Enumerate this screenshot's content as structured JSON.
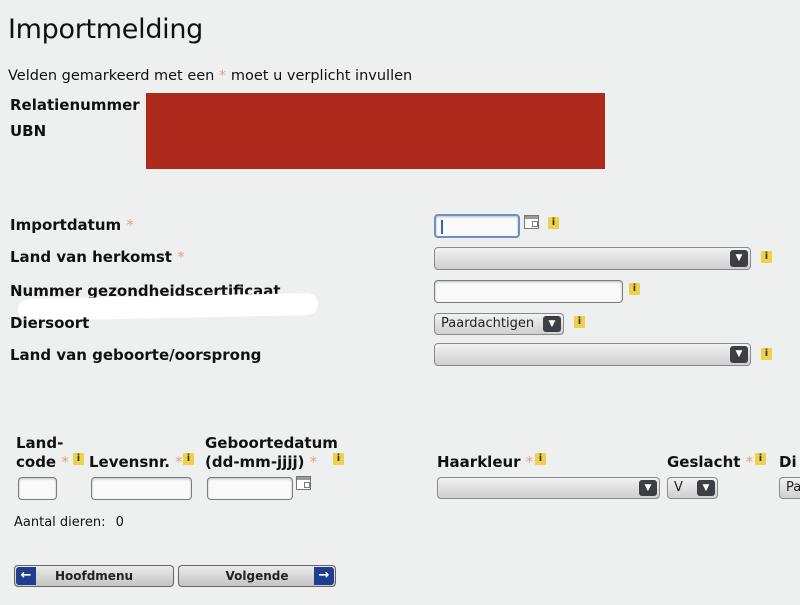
{
  "page": {
    "title": "Importmelding",
    "intro_before": "Velden gemarkeerd met een",
    "required_marker": "*",
    "intro_after": "moet u verplicht invullen"
  },
  "header_fields": {
    "relatienummer_label": "Relatienummer",
    "ubn_label": "UBN"
  },
  "form": {
    "importdatum_label": "Importdatum",
    "land_herkomst_label": "Land van herkomst",
    "certificaat_label": "Nummer gezondheidscertificaat",
    "diersoort_label": "Diersoort",
    "diersoort_value": "Paardachtigen",
    "land_geboorte_label": "Land van geboorte/oorsprong",
    "info_glyph": "i",
    "dropdown_glyph": "▼"
  },
  "animal_table": {
    "landcode_line1": "Land-",
    "landcode_line2": "code",
    "levensnr_label": "Levensnr.",
    "geboortedatum_line1": "Geboortedatum",
    "geboortedatum_line2": "(dd-mm-jjjj)",
    "haarkleur_label": "Haarkleur",
    "geslacht_label": "Geslacht",
    "geslacht_value": "V",
    "cut_header": "Di",
    "cut_value": "Pa"
  },
  "summary": {
    "aantal_label": "Aantal dieren:",
    "aantal_value": "0"
  },
  "nav": {
    "hoofdmenu_label": "Hoofdmenu",
    "volgende_label": "Volgende",
    "back_glyph": "←",
    "next_glyph": "→"
  },
  "colors": {
    "redaction": "#ad2a1c",
    "required_star": "#e8a17a",
    "info_badge": "#ecd24c",
    "nav_arrow": "#1f3e8e"
  }
}
